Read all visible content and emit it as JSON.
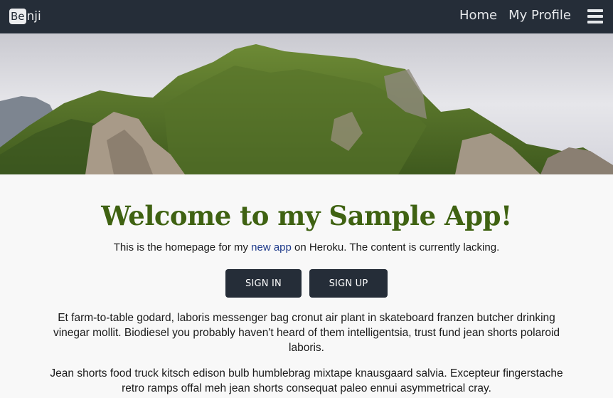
{
  "navbar": {
    "brand_box": "Be",
    "brand_rest": "nji",
    "links": [
      "Home",
      "My Profile"
    ],
    "menu_icon": "hamburger-menu-icon"
  },
  "hero": {
    "image": "mountain-landscape",
    "colors": {
      "sky": "#d8d8de",
      "forest": "#5d7a2c",
      "rock": "#a89a88"
    }
  },
  "main": {
    "title": "Welcome to my Sample App!",
    "subtitle_before": "This is the homepage for my ",
    "subtitle_link": "new app",
    "subtitle_after": " on Heroku. The content is currently lacking.",
    "signin_label": "SIGN IN",
    "signup_label": "SIGN UP",
    "paragraphs": [
      "Et farm-to-table godard, laboris messenger bag cronut air plant in skateboard franzen butcher drinking vinegar mollit. Biodiesel you probably haven't heard of them intelligentsia, trust fund jean shorts polaroid laboris.",
      "Jean shorts food truck kitsch edison bulb humblebrag mixtape knausgaard salvia. Excepteur fingerstache retro ramps offal meh jean shorts consequat paleo ennui asymmetrical cray."
    ]
  },
  "colors": {
    "nav_bg": "#252d38",
    "title": "#3f6212",
    "link": "#1e3a8a",
    "page_bg": "#f8f8f8"
  }
}
